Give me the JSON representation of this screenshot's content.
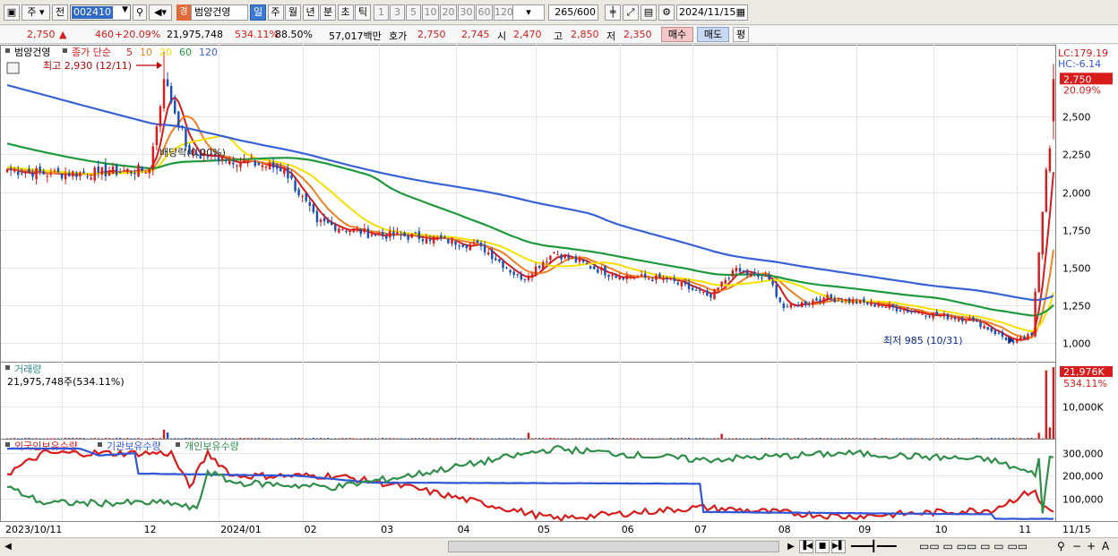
{
  "toolbar": {
    "period_main": "주",
    "prev_label": "전",
    "code": "002410",
    "stock_name": "범양건영",
    "stock_tag": "경",
    "periods": [
      "일",
      "주",
      "월",
      "년",
      "분",
      "초",
      "틱"
    ],
    "selected_period": "일",
    "intervals": [
      "1",
      "3",
      "5",
      "10",
      "20",
      "30",
      "60",
      "120"
    ],
    "count": "265",
    "count_max": "/600",
    "date": "2024/11/15"
  },
  "quote": {
    "price": "2,750",
    "change_arrow": "▲",
    "change": "460",
    "change_pct": "+20.09%",
    "volume": "21,975,748",
    "volume_ratio": "534.11%",
    "turnover_ratio": "88.50%",
    "amount": "57,017백만",
    "hoga_label": "호가",
    "ask": "2,750",
    "bid": "2,745",
    "open_label": "시",
    "open": "2,470",
    "high_label": "고",
    "high": "2,850",
    "low_label": "저",
    "low": "2,350",
    "buy_label": "매수",
    "sell_label": "매도",
    "avg_label": "평"
  },
  "colors": {
    "ma5": "#d81b1b",
    "ma10": "#f08020",
    "ma20": "#f5e000",
    "ma60": "#1e9a3c",
    "ma120": "#3a62d8",
    "up": "#d81b1b",
    "down": "#1a4fb8",
    "foreign": "#d81b1b",
    "institution": "#2f56d6",
    "individual": "#2f8f4a"
  },
  "chart_data": [
    {
      "type": "candlestick",
      "title": "범양건영",
      "ma_label": "종가 단순",
      "ma_periods": [
        "5",
        "10",
        "20",
        "60",
        "120"
      ],
      "y_ticks": [
        1000,
        1250,
        1500,
        1750,
        2000,
        2250,
        2500
      ],
      "y_tick_labels": [
        "1,000",
        "1,250",
        "1,500",
        "1,750",
        "2,000",
        "2,250",
        "2,500"
      ],
      "ylim": [
        880,
        2930
      ],
      "lc_label": "LC:179.19",
      "hc_label": "HC:-6.14",
      "current_price_label": "2,750",
      "current_pct_label": "20.09%",
      "high_annotation": "최고 2,930 (12/11)",
      "low_annotation": "최저 985 (10/31)",
      "exright_annotation": "배당락(0.00%)",
      "x_labels": [
        "2023/10/11",
        "12",
        "2024/01",
        "02",
        "03",
        "04",
        "05",
        "06",
        "07",
        "08",
        "09",
        "10",
        "11",
        "11/15"
      ],
      "ohlc_anchors": [
        {
          "date": "2023/10/11",
          "close": 2150
        },
        {
          "date": "2023/10/27",
          "close": 2120
        },
        {
          "date": "2023/11/15",
          "close": 2130
        },
        {
          "date": "2023/12/05",
          "close": 2150
        },
        {
          "date": "2023/12/11",
          "close": 2750,
          "high": 2930
        },
        {
          "date": "2023/12/20",
          "close": 2250
        },
        {
          "date": "2024/01/02",
          "close": 2230
        },
        {
          "date": "2024/01/25",
          "close": 2150
        },
        {
          "date": "2024/02/07",
          "close": 1800
        },
        {
          "date": "2024/02/28",
          "close": 1720
        },
        {
          "date": "2024/03/20",
          "close": 1700
        },
        {
          "date": "2024/04/10",
          "close": 1640
        },
        {
          "date": "2024/04/25",
          "close": 1420
        },
        {
          "date": "2024/05/08",
          "close": 1600
        },
        {
          "date": "2024/05/30",
          "close": 1450
        },
        {
          "date": "2024/06/20",
          "close": 1420
        },
        {
          "date": "2024/07/08",
          "close": 1300
        },
        {
          "date": "2024/07/16",
          "close": 1480
        },
        {
          "date": "2024/07/30",
          "close": 1420
        },
        {
          "date": "2024/08/05",
          "close": 1230
        },
        {
          "date": "2024/08/20",
          "close": 1300
        },
        {
          "date": "2024/09/10",
          "close": 1250
        },
        {
          "date": "2024/09/25",
          "close": 1200
        },
        {
          "date": "2024/10/16",
          "close": 1150
        },
        {
          "date": "2024/10/31",
          "close": 1000,
          "low": 985
        },
        {
          "date": "2024/11/07",
          "close": 1050
        },
        {
          "date": "2024/11/11",
          "close": 1600
        },
        {
          "date": "2024/11/13",
          "close": 2150
        },
        {
          "date": "2024/11/14",
          "close": 2290
        },
        {
          "date": "2024/11/15",
          "open": 2470,
          "high": 2850,
          "low": 2350,
          "close": 2750
        }
      ]
    },
    {
      "type": "bar",
      "title": "거래량",
      "info_label": "21,975,748주(534.11%)",
      "y_ticks": [
        10000
      ],
      "y_tick_labels": [
        "10,000K"
      ],
      "current_label": "21,976K",
      "current_pct_label": "534.11%",
      "ylim": [
        0,
        22000
      ],
      "spikes": [
        {
          "date": "2023/12/11",
          "value": 2800
        },
        {
          "date": "2023/12/12",
          "value": 1900
        },
        {
          "date": "2024/04/29",
          "value": 1800
        },
        {
          "date": "2024/07/11",
          "value": 1500
        },
        {
          "date": "2024/11/11",
          "value": 1800
        },
        {
          "date": "2024/11/13",
          "value": 21000
        },
        {
          "date": "2024/11/14",
          "value": 3500
        },
        {
          "date": "2024/11/15",
          "value": 21976
        }
      ]
    },
    {
      "type": "line",
      "series_names": [
        "외국인보유수량",
        "기관보유수량",
        "개인보유수량"
      ],
      "y_ticks": [
        100000,
        200000,
        300000
      ],
      "y_tick_labels": [
        "100,000",
        "200,000",
        "300,000"
      ],
      "ylim": [
        0,
        340000
      ]
    }
  ]
}
